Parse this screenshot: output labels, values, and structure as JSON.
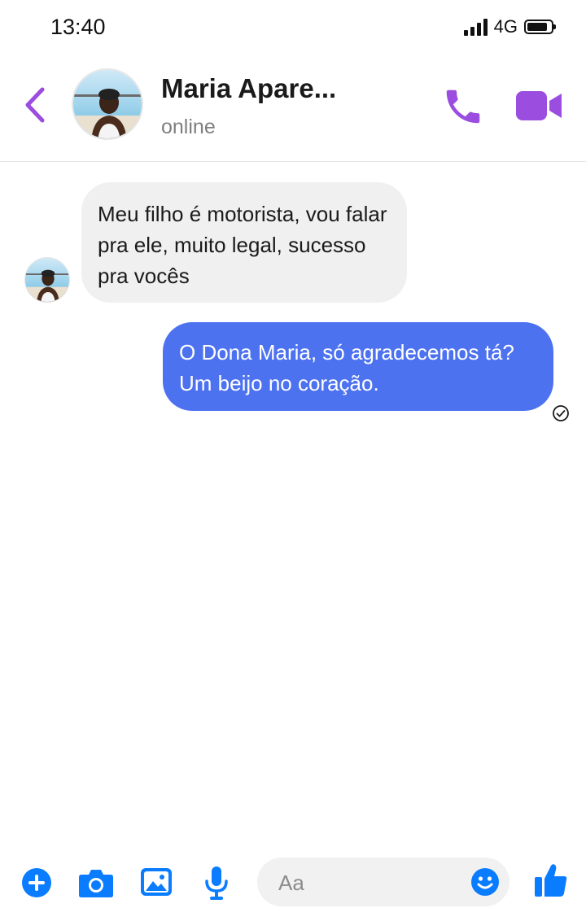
{
  "status_bar": {
    "time": "13:40",
    "network": "4G",
    "signal_icon": "signal-bars-icon",
    "battery_icon": "battery-icon"
  },
  "header": {
    "contact_name": "Maria Apare...",
    "presence": "online",
    "back_icon": "chevron-left-icon",
    "call_icon": "phone-icon",
    "video_icon": "video-camera-icon",
    "accent_color": "#9b4de0"
  },
  "messages": [
    {
      "direction": "incoming",
      "text": "Meu filho é motorista, vou falar pra ele, muito legal, sucesso pra vocês",
      "bubble_color": "#f0f0f0"
    },
    {
      "direction": "outgoing",
      "text": "O Dona Maria, só agradecemos tá? Um beijo no coração.",
      "bubble_color": "#4d72f0",
      "status_icon": "sent-check-icon"
    }
  ],
  "composer": {
    "placeholder": "Aa",
    "icons": [
      "plus-icon",
      "camera-icon",
      "image-icon",
      "microphone-icon",
      "emoji-icon",
      "thumbs-up-icon"
    ],
    "icon_color": "#0a7cff"
  }
}
